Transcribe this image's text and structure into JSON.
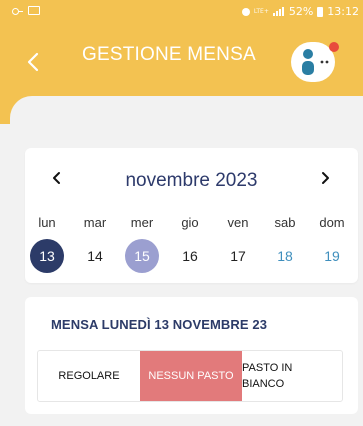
{
  "status_bar": {
    "battery": "52%",
    "time": "13:12",
    "network": "LTE+"
  },
  "header": {
    "title": "GESTIONE MENSA",
    "back_icon": "chevron-left-icon",
    "avatar_icon": "user-avatar-icon",
    "notification_color": "#e84b3c",
    "background": "#f3c251"
  },
  "calendar": {
    "month": "novembre 2023",
    "weekdays": [
      "lun",
      "mar",
      "mer",
      "gio",
      "ven",
      "sab",
      "dom"
    ],
    "days": [
      "13",
      "14",
      "15",
      "16",
      "17",
      "18",
      "19"
    ],
    "selected_day": "13",
    "highlighted_day": "15",
    "selected_color": "#2c3b68",
    "highlight_color": "#9b9fd0",
    "weekend_color": "#3f8fbd"
  },
  "menu": {
    "title": "MENSA LUNEDÌ 13 NOVEMBRE 23",
    "options": {
      "regular": "REGOLARE",
      "none": "NESSUN PASTO",
      "white_line1": "PASTO IN",
      "white_line2": "BIANCO"
    },
    "selected_option": "NESSUN PASTO",
    "selected_color": "#e27a7b"
  }
}
